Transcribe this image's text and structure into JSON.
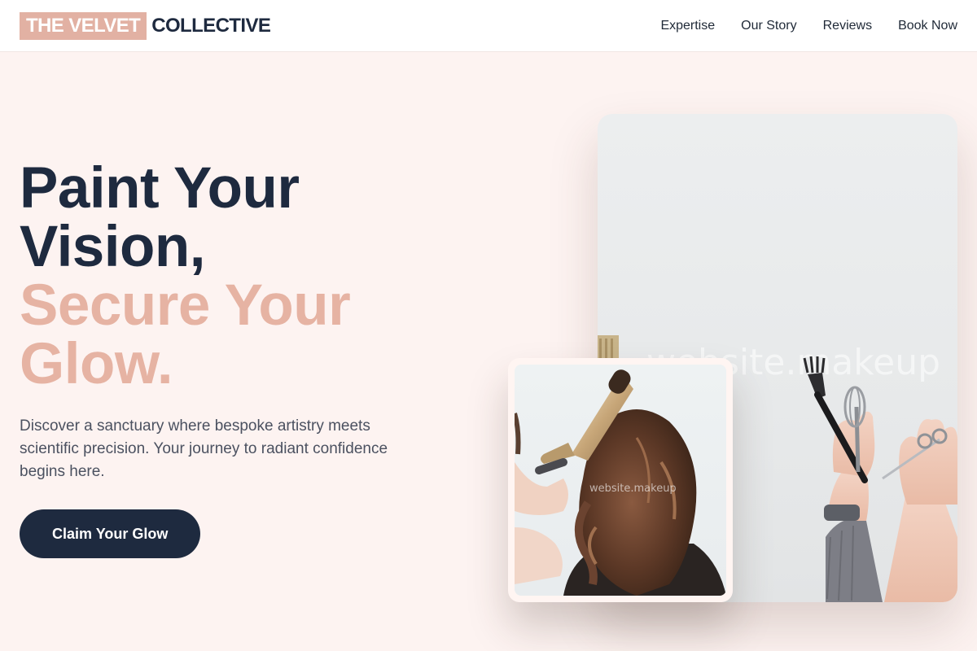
{
  "header": {
    "logo_accent": "THE VELVET",
    "logo_main": "COLLECTIVE",
    "nav": [
      "Expertise",
      "Our Story",
      "Reviews",
      "Book Now"
    ]
  },
  "hero": {
    "title_line1": "Paint Your",
    "title_line2": "Vision,",
    "title_line3": "Secure Your",
    "title_line4": "Glow.",
    "description": "Discover a sanctuary where bespoke artistry meets scientific precision. Your journey to radiant confidence begins here.",
    "cta_label": "Claim Your Glow"
  },
  "images": {
    "large_watermark": "website.makeup",
    "small_watermark": "website.makeup"
  },
  "colors": {
    "accent": "#e2b1a3",
    "navy": "#1e2a3f",
    "background": "#fdf3f1"
  }
}
